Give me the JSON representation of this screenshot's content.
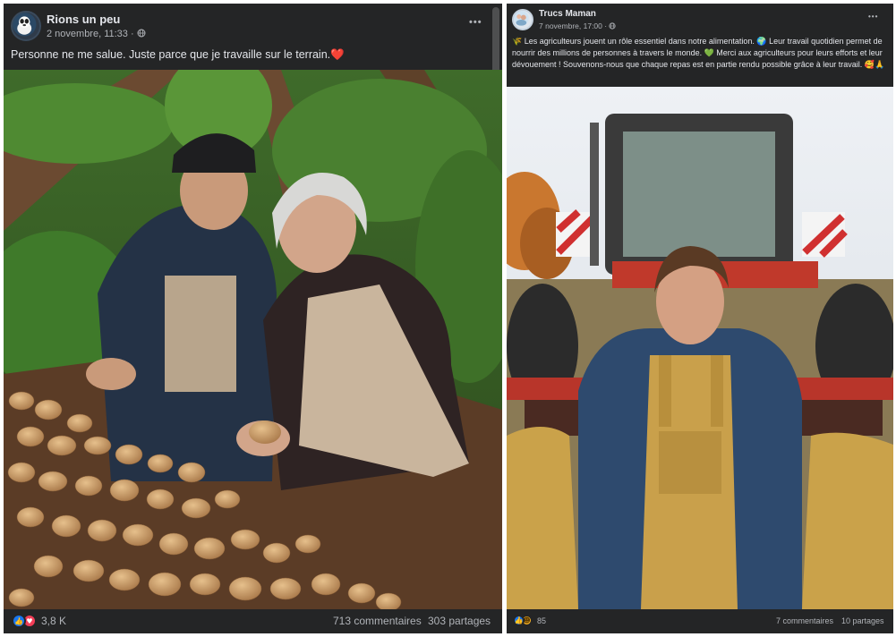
{
  "post1": {
    "author": "Rions un peu",
    "date": "2 novembre, 11:33",
    "text": "Personne ne me salue. Juste parce que je travaille sur le terrain.❤️",
    "more_glyph": "•••",
    "reaction_count": "3,8 K",
    "comments": "713 commentaires",
    "shares": "303 partages"
  },
  "post2": {
    "author": "Trucs Maman",
    "date": "7 novembre, 17:00",
    "text": "🌾 Les agriculteurs jouent un rôle essentiel dans notre alimentation. 🌍 Leur travail quotidien permet de nourrir des millions de personnes à travers le monde. 💚 Merci aux agriculteurs pour leurs efforts et leur dévouement ! Souvenons-nous que chaque repas est en partie rendu possible grâce à leur travail. 🥰🙏",
    "more_glyph": "•••",
    "reaction_count": "85",
    "comments": "7 commentaires",
    "shares": "10 partages"
  },
  "icons": {
    "globe": "globe-icon",
    "like": "like-reaction-icon",
    "love": "love-reaction-icon",
    "haha": "haha-reaction-icon"
  },
  "colors": {
    "card_bg": "#242526",
    "text": "#e4e6eb",
    "secondary": "#b0b3b8",
    "like_blue": "#1877f2",
    "love_red": "#f33e58",
    "haha_yellow": "#f7b125"
  }
}
